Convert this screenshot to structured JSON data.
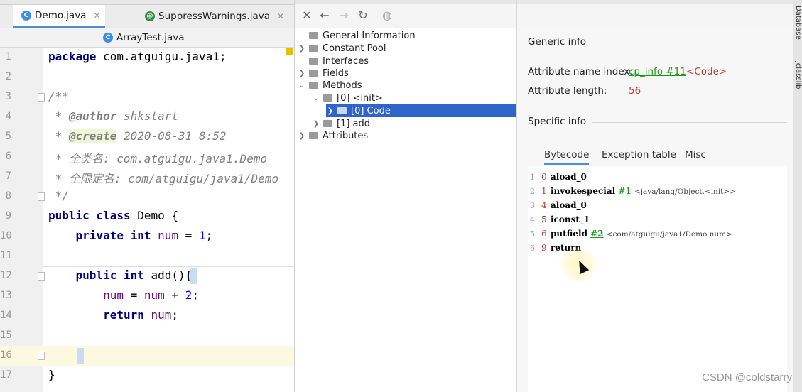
{
  "editor": {
    "tabs_row1": [
      {
        "label": "Demo.java",
        "active": true
      },
      {
        "label": "SuppressWarnings.java",
        "active": false
      }
    ],
    "tab_row2": {
      "label": "ArrayTest.java"
    },
    "lines": [
      {
        "n": "1"
      },
      {
        "n": "2"
      },
      {
        "n": "3"
      },
      {
        "n": "4"
      },
      {
        "n": "5"
      },
      {
        "n": "6"
      },
      {
        "n": "7"
      },
      {
        "n": "8"
      },
      {
        "n": "9"
      },
      {
        "n": "10"
      },
      {
        "n": "11"
      },
      {
        "n": "12"
      },
      {
        "n": "13"
      },
      {
        "n": "14"
      },
      {
        "n": "15"
      },
      {
        "n": "16"
      },
      {
        "n": "17"
      }
    ],
    "code": {
      "l1_kw": "package",
      "l1_rest": " com.atguigu.java1;",
      "l3": "/**",
      "l4_star": " * ",
      "l4_tag": "@author",
      "l4_val": " shkstart",
      "l5_star": " * ",
      "l5_tag": "@create",
      "l5_val": " 2020-08-31 8:52",
      "l6": " * 全类名: com.atguigu.java1.Demo",
      "l7": " * 全限定名: com/atguigu/java1/Demo",
      "l8": " */",
      "l9_kw": "public class",
      "l9_rest": " Demo {",
      "l10_kw": "    private int",
      "l10_fld": " num",
      "l10_eq": " = ",
      "l10_num": "1",
      "l10_end": ";",
      "l12_kw": "    public int",
      "l12_rest": " add(){",
      "l13_a": "        num",
      "l13_b": " = ",
      "l13_c": "num",
      "l13_d": " + ",
      "l13_num": "2",
      "l13_end": ";",
      "l14_kw": "        return",
      "l14_fld": " num",
      "l14_end": ";",
      "l16": "    }",
      "l17": "}"
    }
  },
  "tree": {
    "nodes": {
      "general": "General Information",
      "constant_pool": "Constant Pool",
      "interfaces": "Interfaces",
      "fields": "Fields",
      "methods": "Methods",
      "init": "[0] <init>",
      "code": "[0] Code",
      "add": "[1] add",
      "attributes": "Attributes"
    }
  },
  "info": {
    "generic_title": "Generic info",
    "attr_name_label": "Attribute name index:",
    "attr_name_link": "cp_info #11",
    "attr_name_value": "<Code>",
    "attr_length_label": "Attribute length:",
    "attr_length_value": "56",
    "specific_title": "Specific info",
    "tabs": [
      "Bytecode",
      "Exception table",
      "Misc"
    ],
    "bytecode": [
      {
        "line": "1",
        "offset": "0",
        "op": "aload_0",
        "ref": "",
        "comment": ""
      },
      {
        "line": "2",
        "offset": "1",
        "op": "invokespecial",
        "ref": "#1",
        "comment": "<java/lang/Object.<init>>"
      },
      {
        "line": "3",
        "offset": "4",
        "op": "aload_0",
        "ref": "",
        "comment": ""
      },
      {
        "line": "4",
        "offset": "5",
        "op": "iconst_1",
        "ref": "",
        "comment": ""
      },
      {
        "line": "5",
        "offset": "6",
        "op": "putfield",
        "ref": "#2",
        "comment": "<com/atguigu/java1/Demo.num>"
      },
      {
        "line": "6",
        "offset": "9",
        "op": "return",
        "ref": "",
        "comment": ""
      }
    ]
  },
  "side": {
    "database": "Database",
    "jclasslib": "jclasslib"
  },
  "watermark": "CSDN @coldstarry",
  "colors": {
    "accent": "#2f65ca",
    "link": "#1a9a1a",
    "value_red": "#c43a2a"
  }
}
